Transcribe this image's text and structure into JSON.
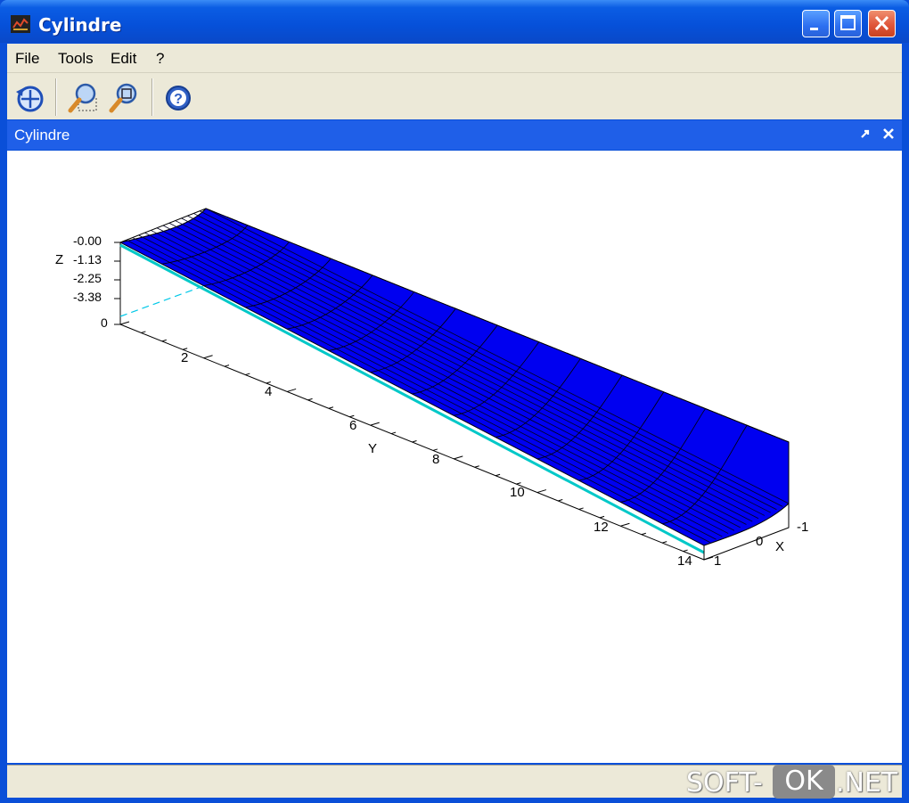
{
  "window": {
    "title": "Cylindre",
    "colors": {
      "titlebar": "#0650d9",
      "chrome": "#ece9d8",
      "surface": "#0000ff",
      "floor_edge": "#00c8c8"
    }
  },
  "menu": [
    "File",
    "Tools",
    "Edit",
    "?"
  ],
  "toolbar": [
    {
      "icon": "rotate-icon"
    },
    {
      "icon": "zoom-in-icon"
    },
    {
      "icon": "zoom-fit-icon"
    },
    {
      "icon": "help-icon"
    }
  ],
  "panel": {
    "title": "Cylindre"
  },
  "plot": {
    "z_axis_label": "Z",
    "z_ticks": [
      "-0.00",
      "-1.13",
      "-2.25",
      "-3.38",
      "0"
    ],
    "y_axis_label": "Y",
    "y_ticks": [
      "2",
      "4",
      "6",
      "8",
      "10",
      "12",
      "14"
    ],
    "x_axis_label": "X",
    "x_ticks": [
      "-1",
      "0",
      "1"
    ]
  },
  "watermark": {
    "left": "SOFT-",
    "box": "OK",
    "right": ".NET"
  }
}
